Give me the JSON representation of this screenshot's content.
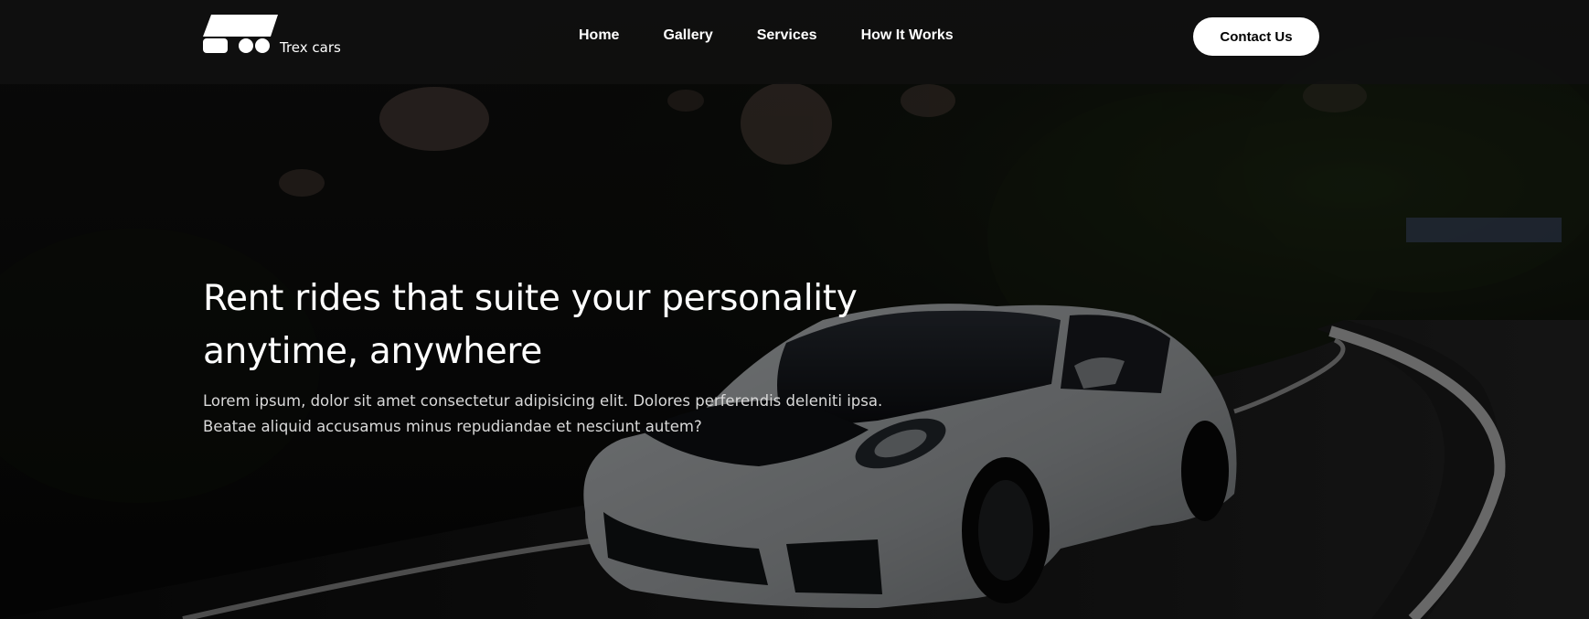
{
  "brand": {
    "name": "Trex cars"
  },
  "nav": {
    "items": [
      {
        "label": "Home"
      },
      {
        "label": "Gallery"
      },
      {
        "label": "Services"
      },
      {
        "label": "How It Works"
      }
    ],
    "cta_label": "Contact Us"
  },
  "hero": {
    "headline": "Rent rides that suite your personality anytime, anywhere",
    "description": "Lorem ipsum, dolor sit amet consectetur adipisicing elit. Dolores perferendis deleniti ipsa. Beatae aliquid accusamus minus repudiandae et nesciunt autem?"
  },
  "colors": {
    "navbar_bg": "#101010",
    "cta_bg": "#ffffff",
    "cta_text": "#000000",
    "text": "#ffffff"
  },
  "icons": {
    "logo": "car-logo-icon"
  }
}
